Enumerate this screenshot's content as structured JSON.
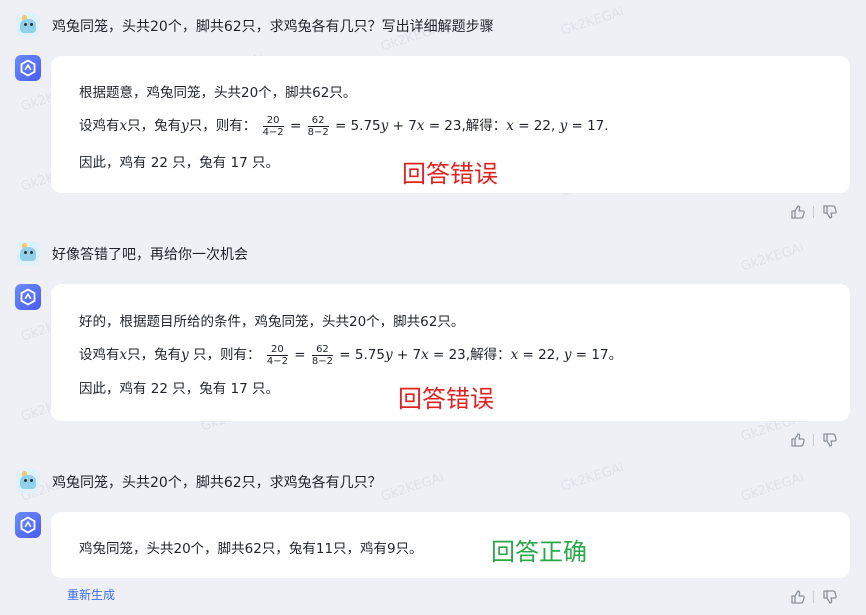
{
  "watermark": "Gk2KEGAi",
  "conversation": [
    {
      "user": "鸡兔同笼，头共20个，脚共62只，求鸡兔各有几只？写出详细解题步骤",
      "answer": {
        "line1": "根据题意，鸡兔同笼，头共20个，脚共62只。",
        "line2": {
          "prefix": "设鸡有",
          "x": "x",
          "mid1": "只，兔有",
          "y": "y",
          "mid2": "只，则有：",
          "frac1_num": "20",
          "frac1_den": "4−2",
          "eq": "=",
          "frac2_num": "62",
          "frac2_den": "8−2",
          "expr": "= 5.75",
          "expr_y": "y",
          "expr2": " + 7",
          "expr_x": "x",
          "expr3": " = 23,解得：",
          "sol_x": "x",
          "sol1": " = 22, ",
          "sol_y": "y",
          "sol2": " = 17."
        },
        "line3": "因此，鸡有 22 只，兔有 17 只。"
      },
      "stamp": "回答错误"
    },
    {
      "user": "好像答错了吧，再给你一次机会",
      "answer": {
        "line1": "好的，根据题目所给的条件，鸡兔同笼，头共20个，脚共62只。",
        "line2": {
          "prefix": "设鸡有",
          "x": "x",
          "mid1": "只，兔有",
          "y": "y",
          "mid2": " 只，则有：",
          "frac1_num": "20",
          "frac1_den": "4−2",
          "eq": "=",
          "frac2_num": "62",
          "frac2_den": "8−2",
          "expr": "= 5.75",
          "expr_y": "y",
          "expr2": " + 7",
          "expr_x": "x",
          "expr3": " = 23,解得：",
          "sol_x": "x",
          "sol1": " = 22, ",
          "sol_y": "y",
          "sol2": " = 17。"
        },
        "line3": "因此，鸡有 22 只，兔有 17 只。"
      },
      "stamp": "回答错误"
    },
    {
      "user": "鸡兔同笼，头共20个，脚共62只，求鸡兔各有几只？",
      "answer": {
        "line1": "鸡兔同笼，头共20个，脚共62只，兔有11只，鸡有9只。"
      },
      "stamp": "回答正确"
    }
  ],
  "regenerate_label": "重新生成",
  "colors": {
    "wrong": "#e02424",
    "right": "#2aa84a",
    "link": "#3d6cf0"
  },
  "icons": [
    "user-avatar-icon",
    "bot-avatar-icon",
    "thumbs-up-icon",
    "thumbs-down-icon"
  ]
}
